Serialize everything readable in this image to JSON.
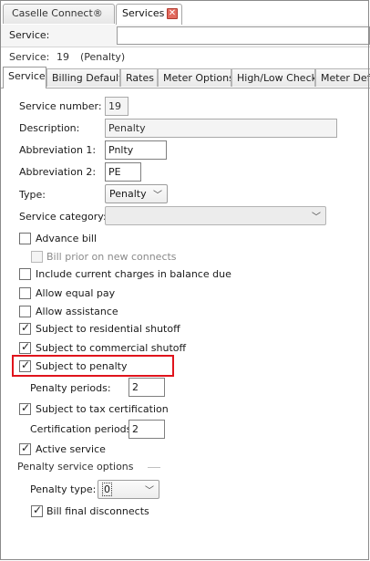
{
  "doc_tabs": [
    {
      "label": "Caselle Connect®"
    },
    {
      "label": "Services"
    }
  ],
  "service_lookup": {
    "label": "Service:",
    "value": ""
  },
  "service_info": {
    "label": "Service:",
    "number": "19",
    "name": "(Penalty)"
  },
  "sub_tabs": [
    "Service",
    "Billing Defaults",
    "Rates",
    "Meter Options",
    "High/Low Checks",
    "Meter Defa"
  ],
  "form": {
    "service_number": {
      "label": "Service number:",
      "value": "19"
    },
    "description": {
      "label": "Description:",
      "value": "Penalty"
    },
    "abbreviation1": {
      "label": "Abbreviation 1:",
      "value": "Pnlty"
    },
    "abbreviation2": {
      "label": "Abbreviation 2:",
      "value": "PE"
    },
    "type": {
      "label": "Type:",
      "value": "Penalty"
    },
    "service_category": {
      "label": "Service category:",
      "value": ""
    }
  },
  "checkboxes": {
    "advance_bill": {
      "label": "Advance bill",
      "checked": false
    },
    "bill_prior": {
      "label": "Bill prior on new connects",
      "checked": false
    },
    "include_current": {
      "label": "Include current charges in balance due",
      "checked": false
    },
    "allow_equal_pay": {
      "label": "Allow equal pay",
      "checked": false
    },
    "allow_assistance": {
      "label": "Allow assistance",
      "checked": false
    },
    "residential_shutoff": {
      "label": "Subject to residential shutoff",
      "checked": true
    },
    "commercial_shutoff": {
      "label": "Subject to commercial shutoff",
      "checked": true
    },
    "subject_penalty": {
      "label": "Subject to penalty",
      "checked": true
    },
    "tax_cert": {
      "label": "Subject to tax certification",
      "checked": true
    },
    "active_service": {
      "label": "Active service",
      "checked": true
    },
    "bill_final": {
      "label": "Bill final disconnects",
      "checked": true
    }
  },
  "penalty_periods": {
    "label": "Penalty periods:",
    "value": "2"
  },
  "certification_periods": {
    "label": "Certification periods:",
    "value": "2"
  },
  "penalty_options": {
    "title": "Penalty service options",
    "type_label": "Penalty type:",
    "type_value": "0"
  },
  "glyphs": {
    "check": "✓",
    "chevron": "﹀",
    "close": "✕"
  },
  "colors": {
    "highlight": "#e0141c"
  }
}
